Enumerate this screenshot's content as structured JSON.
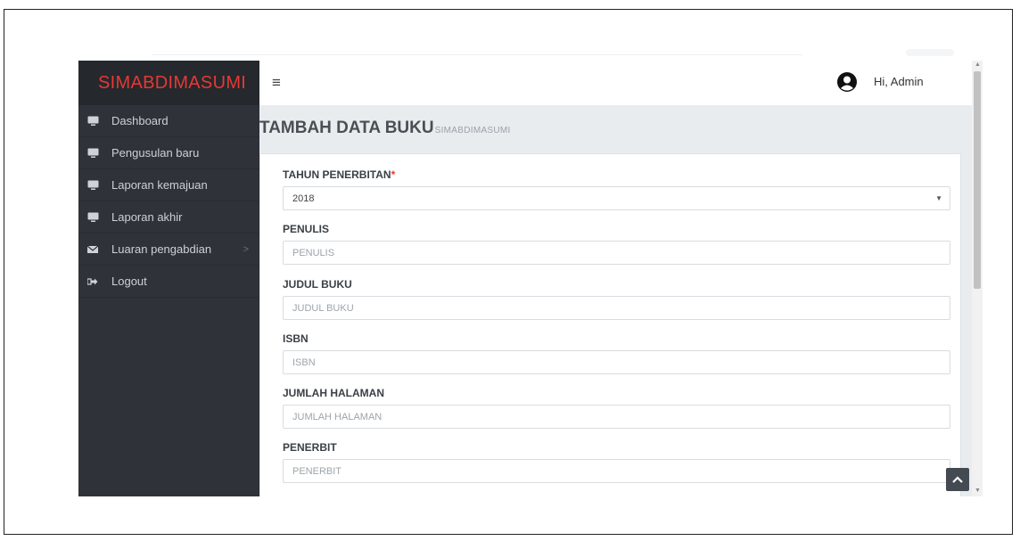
{
  "brand": {
    "name": "SIMABDIMASUMI"
  },
  "sidebar": {
    "items": [
      {
        "label": "Dashboard",
        "icon": "monitor-icon"
      },
      {
        "label": "Pengusulan baru",
        "icon": "monitor-icon"
      },
      {
        "label": "Laporan kemajuan",
        "icon": "monitor-icon"
      },
      {
        "label": "Laporan akhir",
        "icon": "monitor-icon"
      },
      {
        "label": "Luaran pengabdian",
        "icon": "envelope-icon",
        "chevron": ">"
      },
      {
        "label": "Logout",
        "icon": "sign-out-icon"
      }
    ]
  },
  "topbar": {
    "menu_icon": "≡",
    "greeting": "Hi, Admin",
    "avatar_icon": "user-circle-icon"
  },
  "page": {
    "title": "TAMBAH DATA BUKU",
    "subtitle": "SIMABDIMASUMI"
  },
  "form": {
    "tahun": {
      "label": "TAHUN PENERBITAN",
      "required_mark": "*",
      "value": "2018"
    },
    "penulis": {
      "label": "PENULIS",
      "placeholder": "PENULIS"
    },
    "judul": {
      "label": "JUDUL BUKU",
      "placeholder": "JUDUL BUKU"
    },
    "isbn": {
      "label": "ISBN",
      "placeholder": "ISBN"
    },
    "halaman": {
      "label": "JUMLAH HALAMAN",
      "placeholder": "JUMLAH HALAMAN"
    },
    "penerbit": {
      "label": "PENERBIT",
      "placeholder": "PENERBIT"
    }
  },
  "colors": {
    "brand_red": "#e53935",
    "sidebar_bg": "#2f3238",
    "content_bg": "#e9ecef"
  }
}
